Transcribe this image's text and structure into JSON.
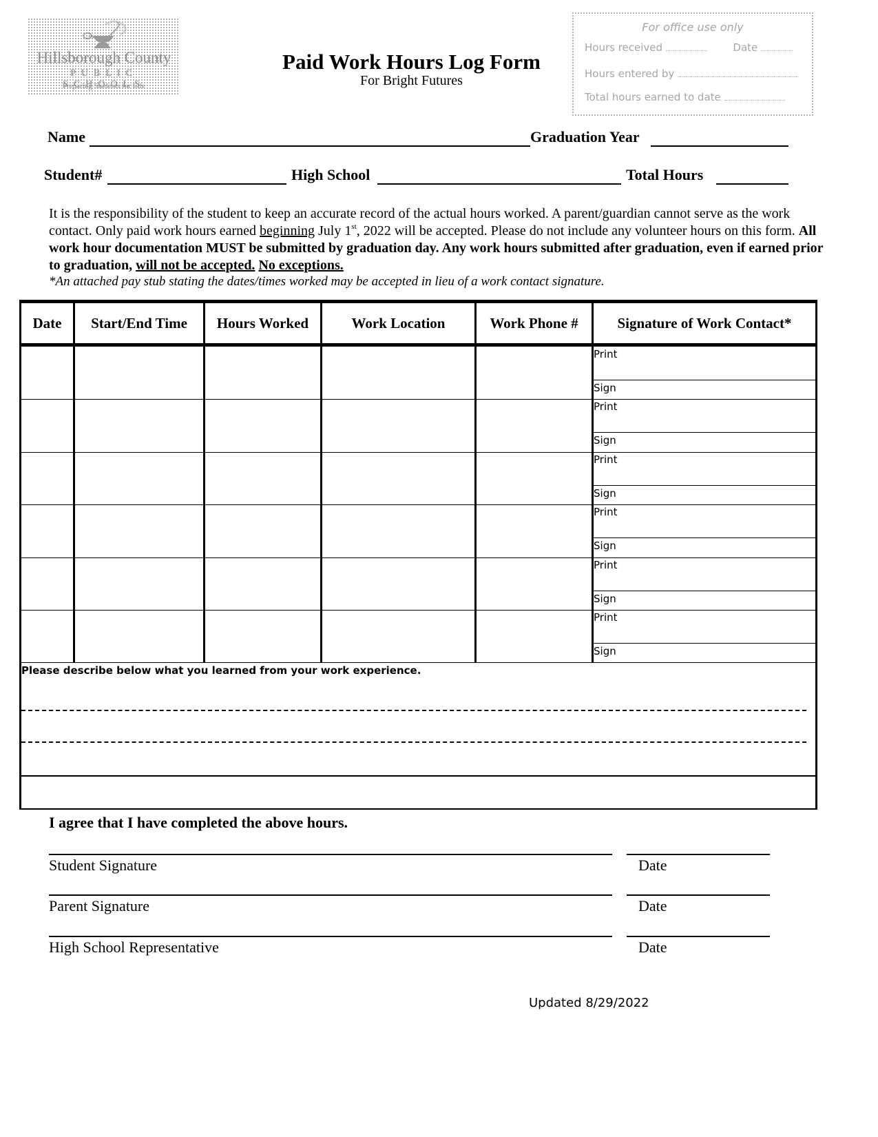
{
  "logo": {
    "name": "Hillsborough County",
    "subname": "PUBLIC SCHOOLS",
    "tagline": "Preparing Students for Life",
    "icon": "lamp-of-learning-icon"
  },
  "header": {
    "title": "Paid Work Hours Log Form",
    "subtitle": "For Bright Futures"
  },
  "office_box": {
    "heading": "For office use only",
    "hours_received_label": "Hours received",
    "date_label": "Date",
    "hours_entered_by_label": "Hours entered by",
    "total_hours_label": "Total hours earned to date"
  },
  "student_info": {
    "name_label": "Name",
    "graduation_year_label": "Graduation Year",
    "student_number_label": "Student#",
    "high_school_label": "High School",
    "total_hours_label": "Total Hours",
    "name_value": "",
    "graduation_year_value": "",
    "student_number_value": "",
    "high_school_value": "",
    "total_hours_value": ""
  },
  "instructions": {
    "p1": "It is the responsibility of the student to keep an accurate record of the actual hours worked. A parent/guardian cannot serve as the work contact. Only paid work hours earned ",
    "p1_underlined": "beginning",
    "p1_date_pre": " July 1",
    "p1_date_sup": "st",
    "p1_after": ", 2022 will be accepted. Please do not include any volunteer hours on this form. ",
    "bold": "All work hour documentation MUST be submitted by graduation day. Any work hours submitted after graduation, even if earned prior to graduation, ",
    "bold_underlined_1": "will not be accepted.",
    "bold_underlined_2": "No exceptions.",
    "note": "*An attached pay stub stating the dates/times worked may be accepted in lieu of a work contact signature."
  },
  "table": {
    "columns": [
      "Date",
      "Start/End Time",
      "Hours Worked",
      "Work Location",
      "Work Phone #",
      "Signature of Work Contact*"
    ],
    "print_label": "Print",
    "sign_label": "Sign",
    "row_count": 6,
    "describe_prompt": "Please describe below what you learned from your work experience."
  },
  "agreement": {
    "statement": "I agree that I have completed the above hours.",
    "lines": [
      {
        "label": "Student Signature",
        "date_label": "Date"
      },
      {
        "label": "Parent Signature",
        "date_label": "Date"
      },
      {
        "label": "High School Representative",
        "date_label": "Date"
      }
    ]
  },
  "footer": {
    "updated": "Updated 8/29/2022"
  }
}
